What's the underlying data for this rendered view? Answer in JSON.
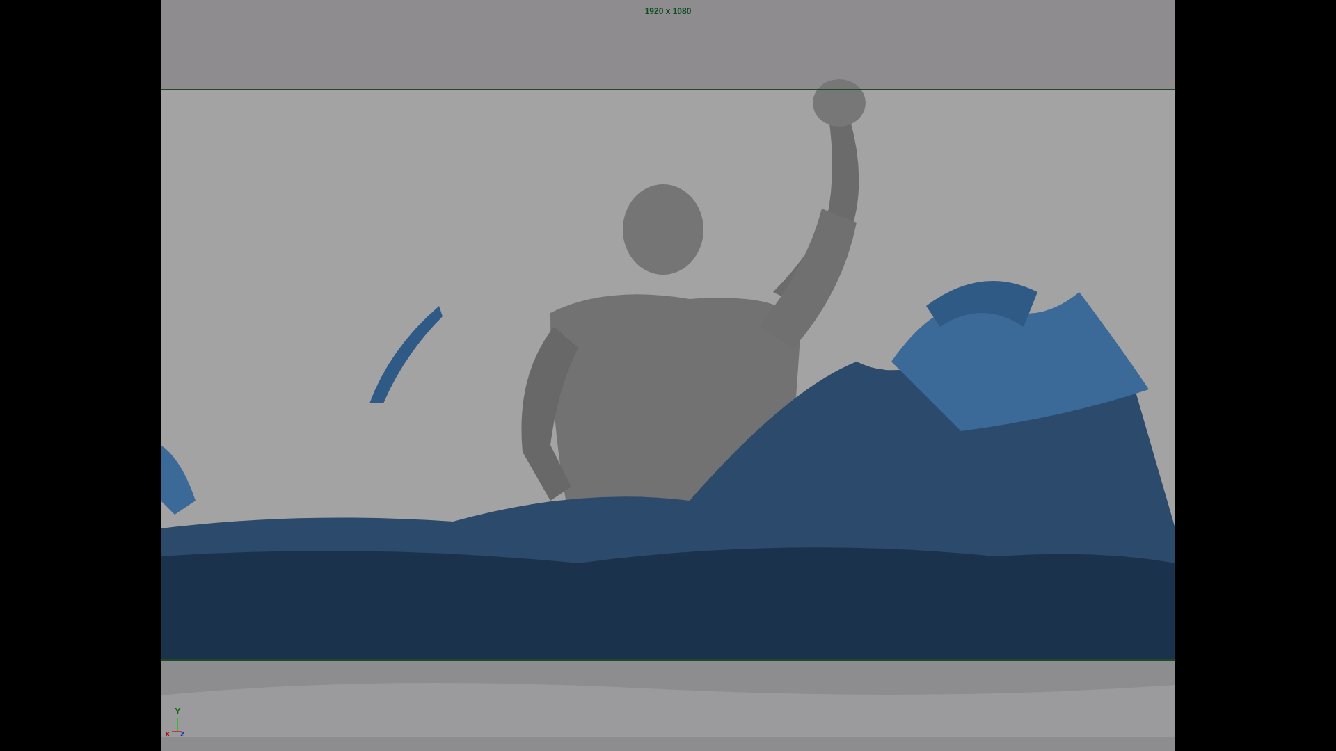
{
  "viewport": {
    "resolution_label": "1920 x 1080",
    "axis_labels": [
      "x",
      "Y",
      "z"
    ]
  }
}
